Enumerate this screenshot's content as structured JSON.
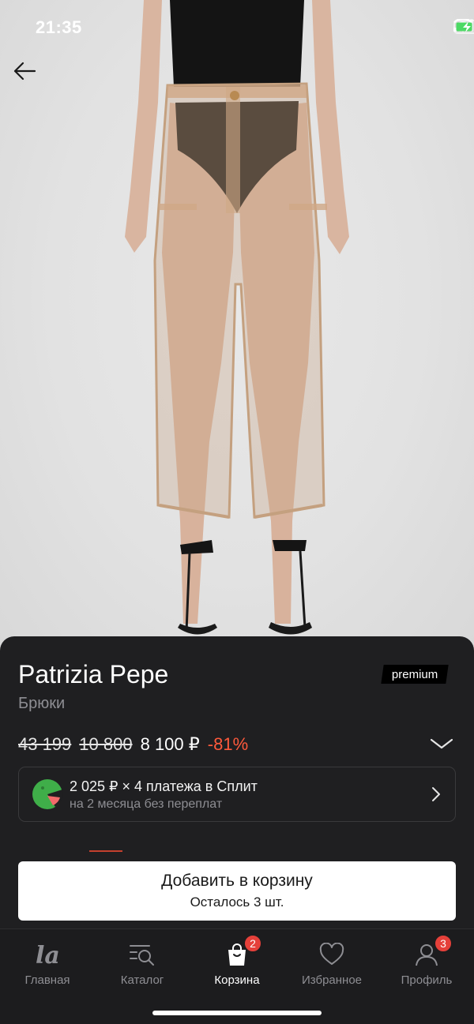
{
  "status_bar": {
    "time": "21:35"
  },
  "product": {
    "brand": "Patrizia Pepe",
    "badge": "premium",
    "category": "Брюки",
    "prices": {
      "original": "43 199",
      "previous": "10 800",
      "current": "8 100 ₽",
      "discount": "-81%"
    }
  },
  "split": {
    "title": "2 025 ₽ × 4 платежа в Сплит",
    "subtitle": "на 2 месяца без переплат"
  },
  "cart_button": {
    "label": "Добавить в корзину",
    "stock": "Осталось 3 шт."
  },
  "tabs": [
    {
      "label": "Главная",
      "icon": "home-logo-icon",
      "badge": ""
    },
    {
      "label": "Каталог",
      "icon": "catalog-search-icon",
      "badge": ""
    },
    {
      "label": "Корзина",
      "icon": "shopping-bag-icon",
      "badge": "2"
    },
    {
      "label": "Избранное",
      "icon": "heart-icon",
      "badge": ""
    },
    {
      "label": "Профиль",
      "icon": "profile-icon",
      "badge": "3"
    }
  ],
  "colors": {
    "accent": "#ff5a3c",
    "badge": "#e5403a",
    "sheet": "#1f1f21",
    "split_green": "#3fae49"
  }
}
